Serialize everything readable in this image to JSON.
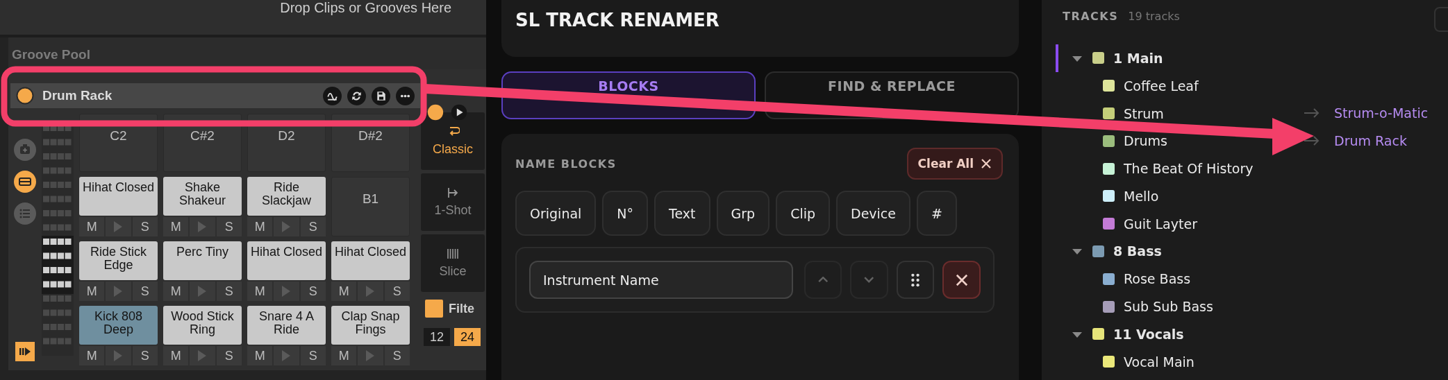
{
  "ableton": {
    "drop_hint": "Drop Clips or Grooves Here",
    "groove_pool": "Groove Pool",
    "device": {
      "name": "Drum Rack",
      "on": true
    },
    "pads": [
      {
        "kind": "empty",
        "label": "C2",
        "selected": false
      },
      {
        "kind": "empty",
        "label": "C#2",
        "selected": false
      },
      {
        "kind": "empty",
        "label": "D2",
        "selected": false
      },
      {
        "kind": "empty",
        "label": "D#2",
        "selected": false
      },
      {
        "kind": "sample",
        "label": "Hihat Closed",
        "mute": "M",
        "solo": "S",
        "selected": false
      },
      {
        "kind": "sample",
        "label": "Shake Shakeur",
        "mute": "M",
        "solo": "S",
        "selected": false
      },
      {
        "kind": "sample",
        "label": "Ride Slackjaw",
        "mute": "M",
        "solo": "S",
        "selected": false
      },
      {
        "kind": "empty",
        "label": "B1",
        "selected": false
      },
      {
        "kind": "sample",
        "label": "Ride Stick Edge",
        "mute": "M",
        "solo": "S",
        "selected": false
      },
      {
        "kind": "sample",
        "label": "Perc Tiny",
        "mute": "M",
        "solo": "S",
        "selected": false
      },
      {
        "kind": "sample",
        "label": "Hihat Closed",
        "mute": "M",
        "solo": "S",
        "selected": false
      },
      {
        "kind": "sample",
        "label": "Hihat Closed",
        "mute": "M",
        "solo": "S",
        "selected": false
      },
      {
        "kind": "sample",
        "label": "Kick 808 Deep",
        "mute": "M",
        "solo": "S",
        "selected": true
      },
      {
        "kind": "sample",
        "label": "Wood Stick Ring",
        "mute": "M",
        "solo": "S",
        "selected": false
      },
      {
        "kind": "sample",
        "label": "Snare 4 A Ride",
        "mute": "M",
        "solo": "S",
        "selected": false
      },
      {
        "kind": "sample",
        "label": "Clap Snap Fings",
        "mute": "M",
        "solo": "S",
        "selected": false
      }
    ],
    "modes": [
      {
        "kind": "classic",
        "label": "Classic",
        "selected": true
      },
      {
        "kind": "oneshot",
        "label": "1-Shot",
        "selected": false
      },
      {
        "kind": "slice",
        "label": "Slice",
        "selected": false
      }
    ],
    "filter": {
      "label": "Filte",
      "checked": true
    },
    "slopes": [
      {
        "label": "12",
        "selected": false
      },
      {
        "label": "24",
        "selected": true
      }
    ]
  },
  "renamer": {
    "title": "SL TRACK RENAMER",
    "tabs": [
      {
        "label": "BLOCKS",
        "selected": true
      },
      {
        "label": "FIND & REPLACE",
        "selected": false
      }
    ],
    "name_blocks": {
      "heading": "NAME BLOCKS",
      "clear_button": "Clear All",
      "chips": [
        "Original",
        "N°",
        "Text",
        "Grp",
        "Clip",
        "Device",
        "#"
      ],
      "blocks": [
        {
          "value": "Instrument Name",
          "controls": [
            {
              "kind": "up",
              "disabled": true
            },
            {
              "kind": "down",
              "disabled": true
            },
            {
              "kind": "grip",
              "disabled": false
            },
            {
              "kind": "delete",
              "disabled": false
            }
          ]
        }
      ]
    }
  },
  "tracks": {
    "heading": "TRACKS",
    "count": "19 tracks",
    "items": [
      {
        "name": "1 Main",
        "color": "#c9cf8a",
        "expanded": true,
        "selected": true,
        "children": [
          {
            "name": "Coffee Leaf",
            "color": "#dde49a",
            "selected": false
          },
          {
            "name": "Strum",
            "color": "#c5cf7a",
            "selected": false,
            "rename": "Strum-o-Matic"
          },
          {
            "name": "Drums",
            "color": "#9bbd7d",
            "selected": false,
            "rename": "Drum Rack"
          },
          {
            "name": "The Beat Of History",
            "color": "#c6f2d6",
            "selected": false
          },
          {
            "name": "Mello",
            "color": "#cdeffa",
            "selected": false
          },
          {
            "name": "Guit Layter",
            "color": "#c37bd6",
            "selected": false
          }
        ]
      },
      {
        "name": "8 Bass",
        "color": "#7c9bb2",
        "expanded": true,
        "selected": false,
        "children": [
          {
            "name": "Rose Bass",
            "color": "#8aaed0",
            "selected": false
          },
          {
            "name": "Sub Sub Bass",
            "color": "#a69db8",
            "selected": false
          }
        ]
      },
      {
        "name": "11 Vocals",
        "color": "#e6e47a",
        "expanded": true,
        "selected": false,
        "children": [
          {
            "name": "Vocal Main",
            "color": "#ebe87a",
            "selected": false
          }
        ]
      }
    ]
  }
}
